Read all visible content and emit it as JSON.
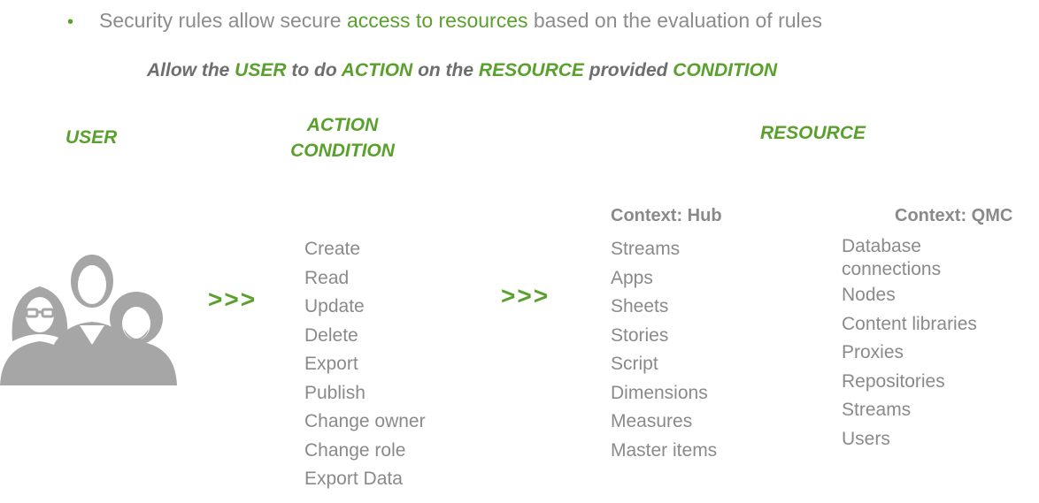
{
  "bullet": {
    "dot": "•",
    "before": "Security rules allow secure ",
    "highlight": "access to resources",
    "after": " based on the evaluation of rules"
  },
  "statement": {
    "p1": "Allow the ",
    "user": "USER",
    "p2": " to do ",
    "action": "ACTION",
    "p3": " on the ",
    "resource": "RESOURCE",
    "p4": " provided ",
    "condition": "CONDITION"
  },
  "headers": {
    "user": "USER",
    "action": "ACTION",
    "condition": "CONDITION",
    "resource": "RESOURCE"
  },
  "arrows": {
    "first": ">>>",
    "second": ">>>"
  },
  "actions": [
    "Create",
    "Read",
    "Update",
    "Delete",
    "Export",
    "Publish",
    "Change owner",
    "Change role",
    "Export Data"
  ],
  "context_hub": {
    "title": "Context: Hub",
    "items": [
      "Streams",
      "Apps",
      "Sheets",
      "Stories",
      "Script",
      "Dimensions",
      "Measures",
      "Master items"
    ]
  },
  "context_qmc": {
    "title": "Context: QMC",
    "items": [
      "Database connections",
      "Nodes",
      "Content libraries",
      "Proxies",
      "Repositories",
      "Streams",
      "Users"
    ]
  },
  "colors": {
    "accent": "#5aa02c",
    "text": "#8a8a8a",
    "statement_text": "#6e6e6e",
    "icon": "#a6a6a6"
  }
}
